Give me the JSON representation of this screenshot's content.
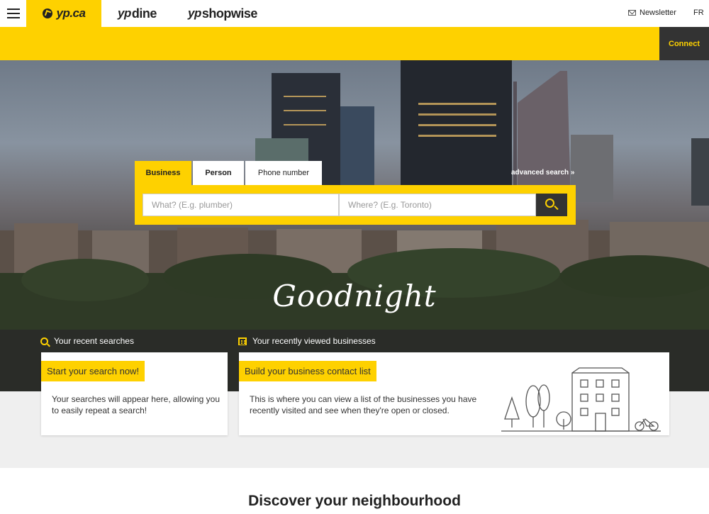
{
  "nav": {
    "brand_yp": "yp.ca",
    "brand_dine_prefix": "yp",
    "brand_dine": "dine",
    "brand_shopwise_prefix": "yp",
    "brand_shopwise": "shopwise",
    "newsletter": "Newsletter",
    "language": "FR"
  },
  "connect": "Connect",
  "search": {
    "tabs": [
      "Business",
      "Person",
      "Phone number"
    ],
    "active_tab": "Business",
    "advanced_search": "advanced search »",
    "what_placeholder": "What? (E.g. plumber)",
    "where_placeholder": "Where? (E.g. Toronto)"
  },
  "greeting": "Goodnight",
  "recent_searches": {
    "label": "Your recent searches",
    "tag": "Start your search now!",
    "body": "Your searches will appear here, allowing you to easily repeat a search!"
  },
  "recently_viewed": {
    "label": "Your recently viewed businesses",
    "tag": "Build your business contact list",
    "body": "This is where you can view a list of the businesses you have recently visited and see when they're open or closed."
  },
  "discover_title": "Discover your neighbourhood",
  "colors": {
    "brand_yellow": "#fed100",
    "dark": "#333333"
  }
}
